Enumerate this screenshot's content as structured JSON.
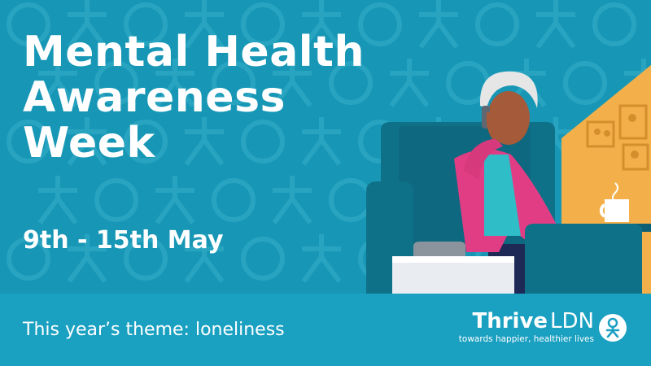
{
  "headline": {
    "line1": "Mental Health",
    "line2": "Awareness",
    "line3": "Week"
  },
  "dates": "9th - 15th May",
  "theme": "This year’s theme: loneliness",
  "brand": {
    "name_bold": "Thrive",
    "name_light": "LDN",
    "tagline": "towards happier, healthier lives",
    "logo_icon": "thrive-person-icon"
  },
  "colors": {
    "background": "#1797b5",
    "footer": "#1aa0c1",
    "accent_yellow": "#f3b04a",
    "cardigan_pink": "#e13d84",
    "armchair_teal": "#0f7188",
    "text": "#ffffff"
  }
}
